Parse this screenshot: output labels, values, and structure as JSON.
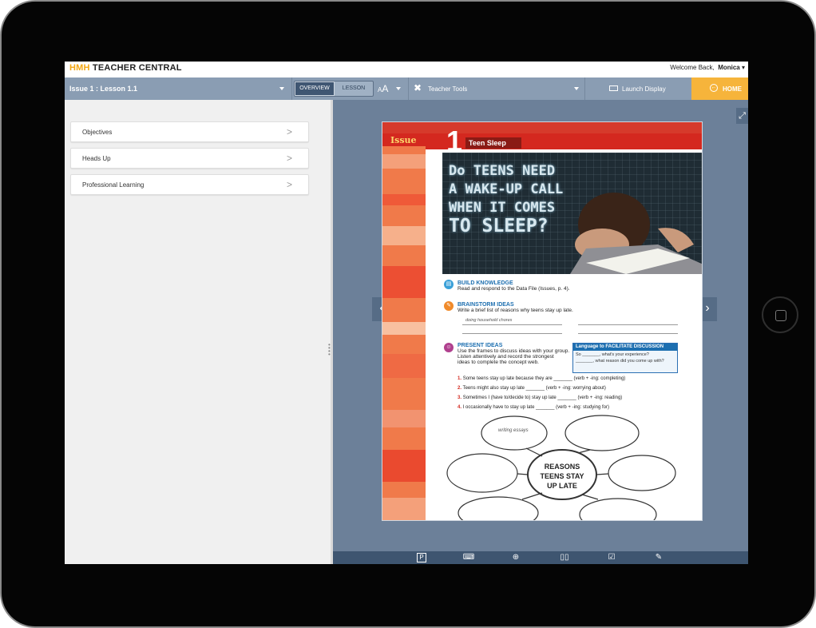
{
  "app": {
    "brand_prefix": "HMH",
    "brand_name": "TEACHER CENTRAL",
    "welcome_text": "Welcome Back,",
    "user_name": "Monica"
  },
  "nav": {
    "lesson_label": "Issue 1 : Lesson 1.1",
    "view_tabs": [
      "OVERVIEW",
      "LESSON"
    ],
    "active_tab": "OVERVIEW",
    "font_size_label": "AA",
    "teacher_tools_label": "Teacher Tools",
    "launch_display_label": "Launch Display",
    "home_label": "HOME",
    "home_color": "#f6b43b",
    "nav_color": "#8a9db3"
  },
  "sidebar": {
    "items": [
      {
        "label": "Objectives"
      },
      {
        "label": "Heads Up"
      },
      {
        "label": "Professional Learning"
      }
    ]
  },
  "page": {
    "issue_label": "Issue",
    "issue_number": "1",
    "issue_title": "Teen Sleep",
    "headline_lines": [
      "Do TEENS NEED",
      "A WAKE-UP CALL",
      "WHEN IT COMES",
      "TO SLEEP?"
    ],
    "build_knowledge": {
      "title": "BUILD KNOWLEDGE",
      "text": "Read and respond to the Data File (Issues, p. 4)."
    },
    "brainstorm": {
      "title": "BRAINSTORM IDEAS",
      "text": "Write a brief list of reasons why teens stay up late.",
      "example": "doing household chores"
    },
    "present": {
      "title": "PRESENT IDEAS",
      "text_lines": [
        "Use the frames to discuss ideas with your group.",
        "Listen attentively and record the strongest",
        "ideas to complete the concept web."
      ]
    },
    "language_box": {
      "title": "Language to FACILITATE DISCUSSION",
      "rows": [
        "So _______, what's your experience?",
        "_______, what reason did you come up with?"
      ]
    },
    "frames": [
      {
        "n": "1.",
        "text": "Some teens stay up late because they are _______ (verb + -ing: completing)"
      },
      {
        "n": "2.",
        "text": "Teens might also stay up late _______ (verb + -ing: worrying about)"
      },
      {
        "n": "3.",
        "text": "Sometimes I (have to/decide to) stay up late _______ (verb + -ing: reading)"
      },
      {
        "n": "4.",
        "text": "I occasionally have to stay up late _______ (verb + -ing: studying for)"
      }
    ],
    "web_center_lines": [
      "REASONS",
      "TEENS STAY",
      "UP LATE"
    ],
    "web_example": "writing essays"
  },
  "reader_tools": [
    "notes-icon",
    "keyboard-icon",
    "zoom-icon",
    "two-page-icon",
    "checklist-icon",
    "annotate-icon"
  ]
}
